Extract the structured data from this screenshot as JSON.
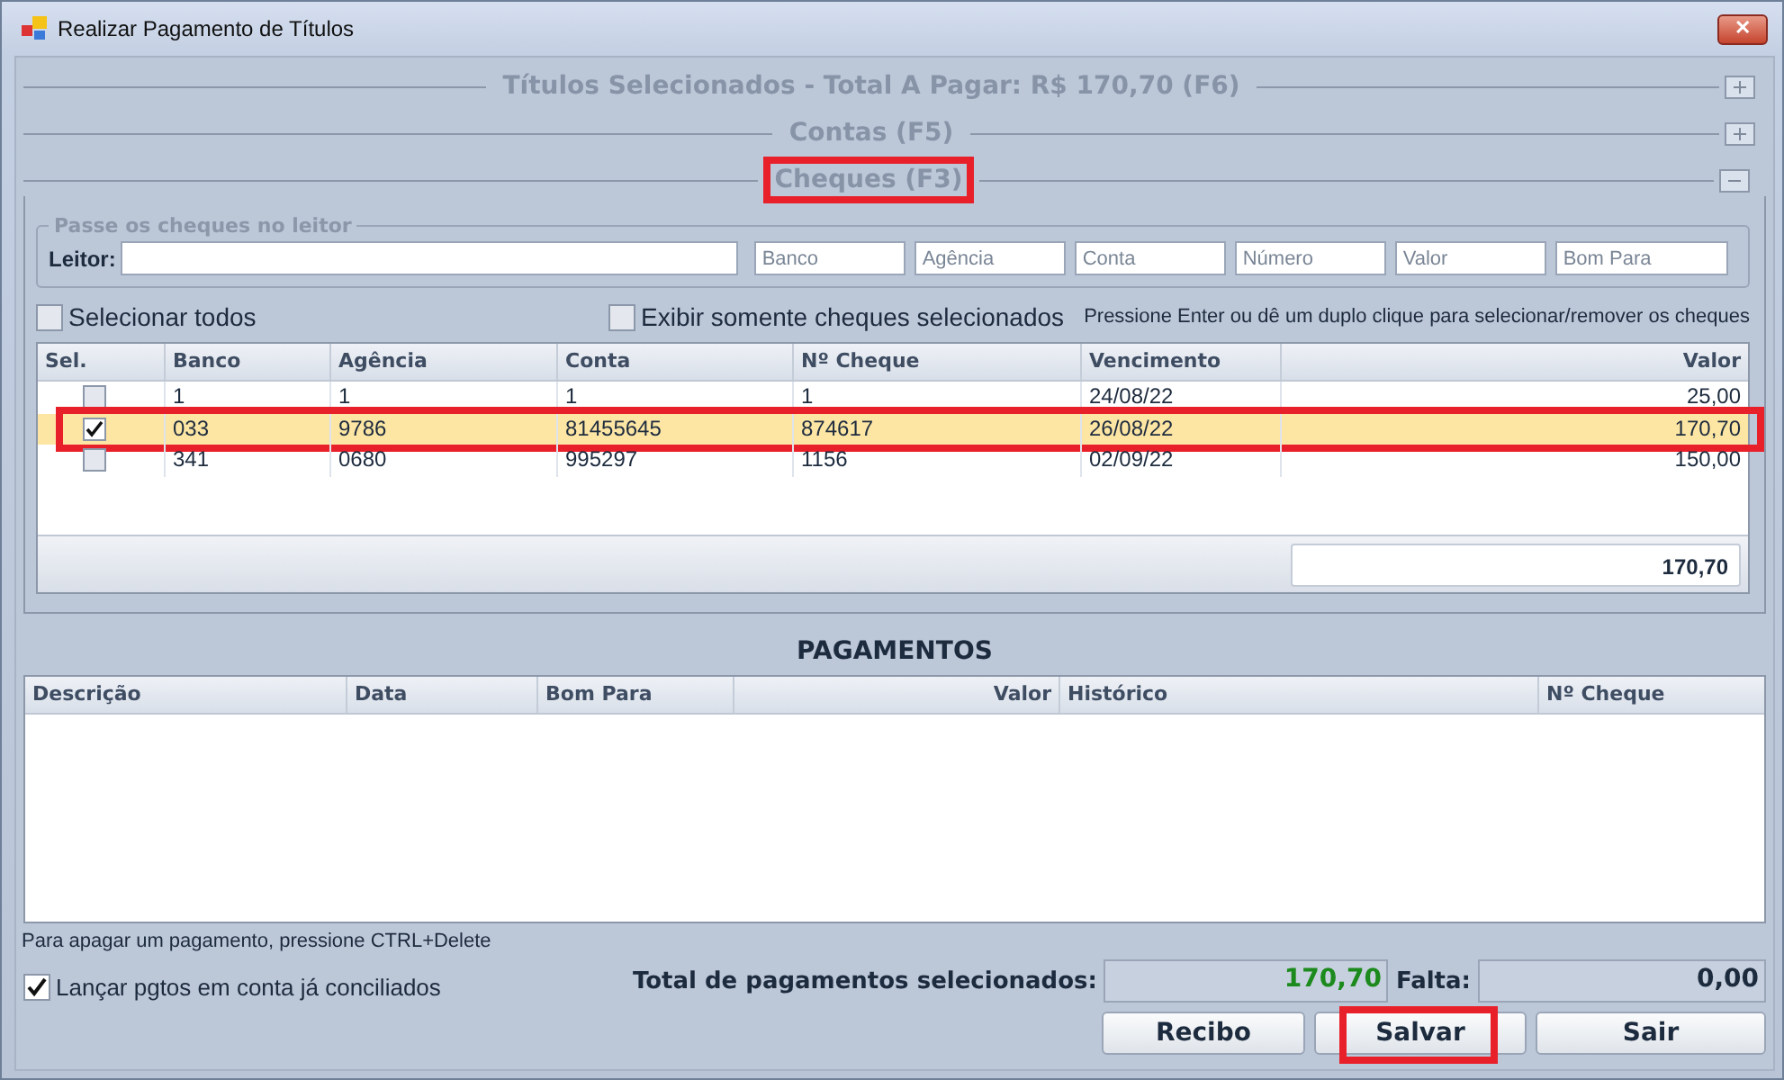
{
  "window": {
    "title": "Realizar Pagamento de Títulos",
    "close": "✕"
  },
  "groups": [
    {
      "title": "Títulos Selecionados - Total A Pagar: R$ 170,70 (F6)",
      "expanded": false,
      "highlighted": false
    },
    {
      "title": "Contas (F5)",
      "expanded": false,
      "highlighted": false
    },
    {
      "title": "Cheques (F3)",
      "expanded": true,
      "highlighted": true
    }
  ],
  "reader": {
    "legend": "Passe os cheques no leitor",
    "label": "Leitor:",
    "fields": [
      {
        "placeholder": "Banco"
      },
      {
        "placeholder": "Agência"
      },
      {
        "placeholder": "Conta"
      },
      {
        "placeholder": "Número"
      },
      {
        "placeholder": "Valor"
      },
      {
        "placeholder": "Bom Para"
      }
    ]
  },
  "options": [
    {
      "label": "Selecionar todos",
      "checked": false
    },
    {
      "label": "Exibir somente cheques selecionados",
      "checked": false
    }
  ],
  "hint": "Pressione Enter ou dê um duplo clique para selecionar/remover os cheques",
  "cheques": {
    "columns": [
      "Sel.",
      "Banco",
      "Agência",
      "Conta",
      "Nº Cheque",
      "Vencimento",
      "Valor"
    ],
    "rows": [
      {
        "checked": false,
        "selected": false,
        "highlighted": false,
        "cells": [
          "",
          "1",
          "1",
          "1",
          "1",
          "24/08/22",
          "25,00"
        ]
      },
      {
        "checked": true,
        "selected": true,
        "highlighted": true,
        "cells": [
          "",
          "033",
          "9786",
          "81455645",
          "874617",
          "26/08/22",
          "170,70"
        ]
      },
      {
        "checked": false,
        "selected": false,
        "highlighted": false,
        "cells": [
          "",
          "341",
          "0680",
          "995297",
          "1156",
          "02/09/22",
          "150,00"
        ]
      }
    ],
    "total": "170,70"
  },
  "payments": {
    "title": "PAGAMENTOS",
    "columns": [
      "Descrição",
      "Data",
      "Bom Para",
      "Valor",
      "Histórico",
      "Nº Cheque"
    ]
  },
  "delete_hint": "Para apagar um pagamento, pressione CTRL+Delete",
  "reconciled": {
    "label": "Lançar pgtos em conta já conciliados",
    "checked": true
  },
  "totals": {
    "label": "Total de pagamentos selecionados:",
    "value": "170,70",
    "missing_label": "Falta:",
    "missing_value": "0,00"
  },
  "buttons": [
    {
      "label": "Recibo",
      "highlighted": false
    },
    {
      "label": "Salvar",
      "highlighted": true
    },
    {
      "label": "Sair",
      "highlighted": false
    }
  ]
}
